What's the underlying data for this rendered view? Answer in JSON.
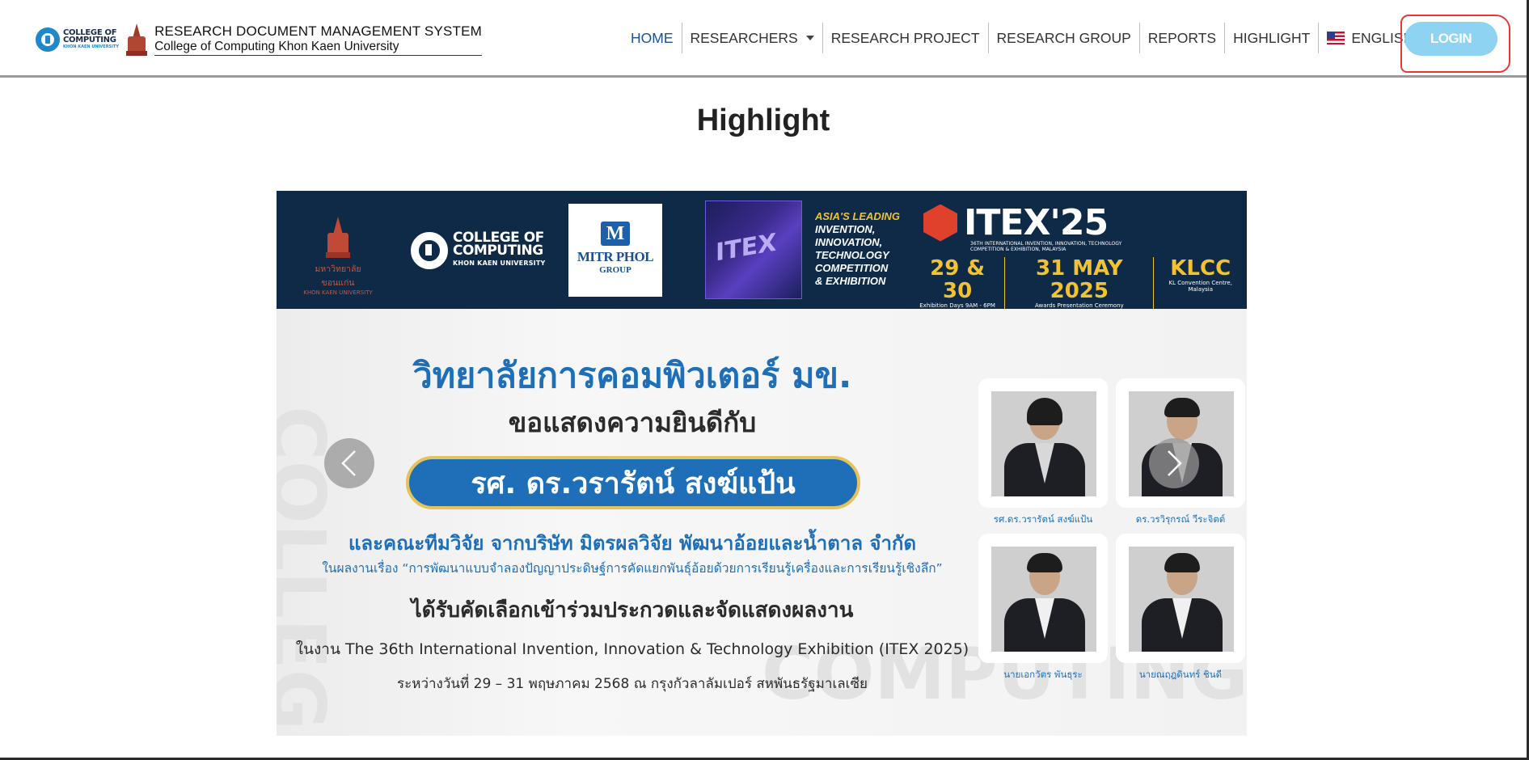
{
  "header": {
    "logo_college": [
      "COLLEGE OF",
      "COMPUTING",
      "KHON KAEN UNIVERSITY"
    ],
    "title": "RESEARCH DOCUMENT MANAGEMENT SYSTEM",
    "subtitle": "College of Computing Khon Kaen University"
  },
  "nav": {
    "items": [
      {
        "label": "HOME",
        "active": true
      },
      {
        "label": "RESEARCHERS",
        "dropdown": true
      },
      {
        "label": "RESEARCH PROJECT"
      },
      {
        "label": "RESEARCH GROUP"
      },
      {
        "label": "REPORTS"
      },
      {
        "label": "HIGHLIGHT"
      },
      {
        "label": "ENGLISH",
        "dropdown": true,
        "icon": "us-flag-icon"
      }
    ],
    "login_label": "LOGIN",
    "login_color": "#8fd3f2",
    "annotation_color": "#e53935"
  },
  "page": {
    "title": "Highlight"
  },
  "banner": {
    "kku_th": "มหาวิทยาลัยขอนแก่น",
    "kku_en": "KHON KAEN UNIVERSITY",
    "cc_line1": "COLLEGE OF",
    "cc_line2": "COMPUTING",
    "cc_line3": "KHON KAEN UNIVERSITY",
    "mitr_name": "MITR PHOL",
    "mitr_group": "GROUP",
    "itex_art_word": "ITEX",
    "tagline_lead": "ASIA'S LEADING",
    "tagline_lines": [
      "INVENTION,",
      "INNOVATION,",
      "TECHNOLOGY",
      "COMPETITION",
      "& EXHIBITION"
    ],
    "itex_title": "ITEX'25",
    "itex_sub": "36TH INTERNATIONAL INVENTION, INNOVATION, TECHNOLOGY COMPETITION & EXHIBITION, MALAYSIA",
    "dates": [
      {
        "big": "29 & 30",
        "mini": "Exhibition Days 9AM - 6PM"
      },
      {
        "big": "31 MAY 2025",
        "mini": "Awards Presentation Ceremony"
      },
      {
        "big": "KLCC",
        "mini": "KL Convention Centre, Malaysia"
      }
    ],
    "headline": "วิทยาลัยการคอมพิวเตอร์ มข.",
    "congrats": "ขอแสดงความยินดีกับ",
    "name": "รศ. ดร.วรารัตน์ สงฆ์แป้น",
    "team": "และคณะทีมวิจัย จากบริษัท มิตรผลวิจัย พัฒนาอ้อยและน้ำตาล จำกัด",
    "topic": "ในผลงานเรื่อง “การพัฒนาแบบจำลองปัญญาประดิษฐ์การคัดแยกพันธุ์อ้อยด้วยการเรียนรู้เครื่องและการเรียนรู้เชิงลึก”",
    "selected": "ได้รับคัดเลือกเข้าร่วมประกวดและจัดแสดงผลงาน",
    "event": "ในงาน The 36th International Invention, Innovation & Technology Exhibition (ITEX 2025)",
    "date_line": "ระหว่างวันที่ 29 – 31 พฤษภาคม 2568 ณ กรุงกัวลาลัมเปอร์ สหพันธรัฐมาเลเซีย",
    "people": [
      {
        "name": "รศ.ดร.วรารัตน์ สงฆ์แป้น"
      },
      {
        "name": "ดร.วรวิรุกรณ์ วีระจิตต์"
      },
      {
        "name": "นายเอกวัตร พันธุระ"
      },
      {
        "name": "นายณฤฎดินทร์ ชินดี"
      }
    ],
    "bg_words": [
      "COLLEGE",
      "COMPUTING"
    ]
  }
}
